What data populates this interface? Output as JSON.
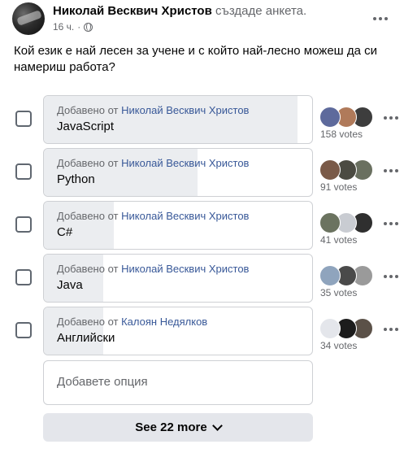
{
  "post": {
    "author": "Николай Весквич Христов",
    "action": "създаде анкета.",
    "time": "16 ч.",
    "question": "Кой език е най лесен за учене и с който най-лесно можеш да си намериш работа?"
  },
  "poll": {
    "options": [
      {
        "added_prefix": "Добавено от",
        "added_by": "Николай Весквич Христов",
        "text": "JavaScript",
        "votes": "158 votes",
        "vote_share": 0.94,
        "voter_colors": [
          "#5e6a9c",
          "#b07a5a",
          "#3d3d3d"
        ]
      },
      {
        "added_prefix": "Добавено от",
        "added_by": "Николай Весквич Христов",
        "text": "Python",
        "votes": "91 votes",
        "vote_share": 0.57,
        "voter_colors": [
          "#7a5a48",
          "#4b4b42",
          "#6a7060"
        ]
      },
      {
        "added_prefix": "Добавено от",
        "added_by": "Николай Весквич Христов",
        "text": "C#",
        "votes": "41 votes",
        "vote_share": 0.26,
        "voter_colors": [
          "#6b7360",
          "#c9ccd2",
          "#2f2f2f"
        ]
      },
      {
        "added_prefix": "Добавено от",
        "added_by": "Николай Весквич Христов",
        "text": "Java",
        "votes": "35 votes",
        "vote_share": 0.22,
        "voter_colors": [
          "#8fa4bd",
          "#4a4a4a",
          "#9a9a9a"
        ]
      },
      {
        "added_prefix": "Добавено от",
        "added_by": "Калоян Недялков",
        "text": "Английски",
        "votes": "34 votes",
        "vote_share": 0.22,
        "voter_colors": [
          "#e4e6eb",
          "#1c1c1c",
          "#5b5148"
        ]
      }
    ],
    "add_option_placeholder": "Добавете опция",
    "see_more_label": "See 22 more"
  },
  "icons": {
    "post_menu": "more-horizontal-icon",
    "option_menu": "more-horizontal-icon",
    "privacy": "globe-icon",
    "see_more": "chevron-down-icon"
  }
}
